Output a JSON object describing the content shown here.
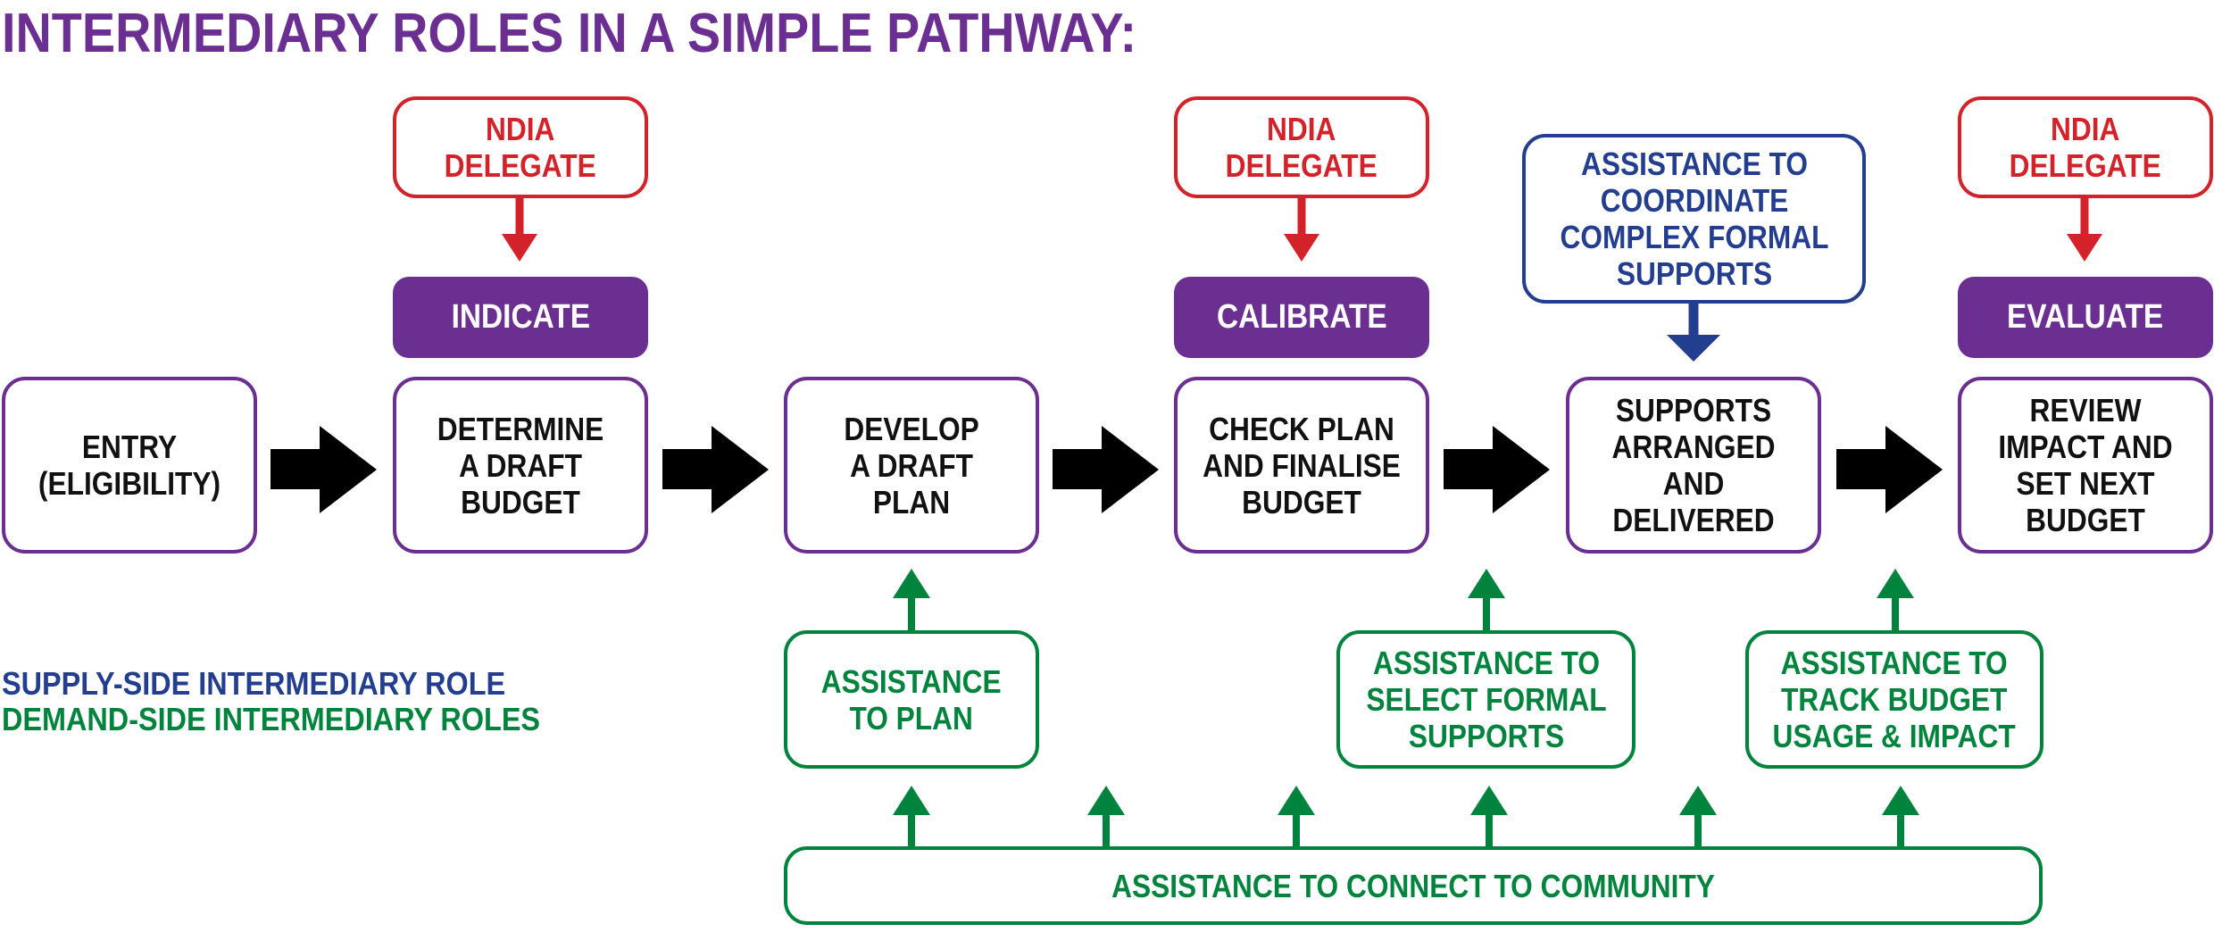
{
  "title": "INTERMEDIARY ROLES IN A SIMPLE PATHWAY:",
  "colors": {
    "purple": "#6a2f91",
    "red": "#d3222a",
    "blue": "#233e8f",
    "green": "#00843d",
    "black": "#000000"
  },
  "pathway_steps": [
    {
      "label": "ENTRY\n(ELIGIBILITY)"
    },
    {
      "label": "DETERMINE\nA DRAFT\nBUDGET"
    },
    {
      "label": "DEVELOP\nA DRAFT\nPLAN"
    },
    {
      "label": "CHECK PLAN\nAND FINALISE\nBUDGET"
    },
    {
      "label": "SUPPORTS\nARRANGED\nAND\nDELIVERED"
    },
    {
      "label": "REVIEW\nIMPACT AND\nSET NEXT\nBUDGET"
    }
  ],
  "ndia_delegates": [
    {
      "label": "NDIA\nDELEGATE",
      "action": "INDICATE"
    },
    {
      "label": "NDIA\nDELEGATE",
      "action": "CALIBRATE"
    },
    {
      "label": "NDIA\nDELEGATE",
      "action": "EVALUATE"
    }
  ],
  "supply_side": {
    "label": "ASSISTANCE TO\nCOORDINATE\nCOMPLEX FORMAL\nSUPPORTS"
  },
  "demand_side": [
    {
      "label": "ASSISTANCE\nTO PLAN"
    },
    {
      "label": "ASSISTANCE TO\nSELECT FORMAL\nSUPPORTS"
    },
    {
      "label": "ASSISTANCE TO\nTRACK BUDGET\nUSAGE & IMPACT"
    }
  ],
  "community": {
    "label": "ASSISTANCE TO CONNECT TO COMMUNITY"
  },
  "legend": {
    "supply": "SUPPLY-SIDE INTERMEDIARY ROLE",
    "demand": "DEMAND-SIDE INTERMEDIARY ROLES"
  }
}
